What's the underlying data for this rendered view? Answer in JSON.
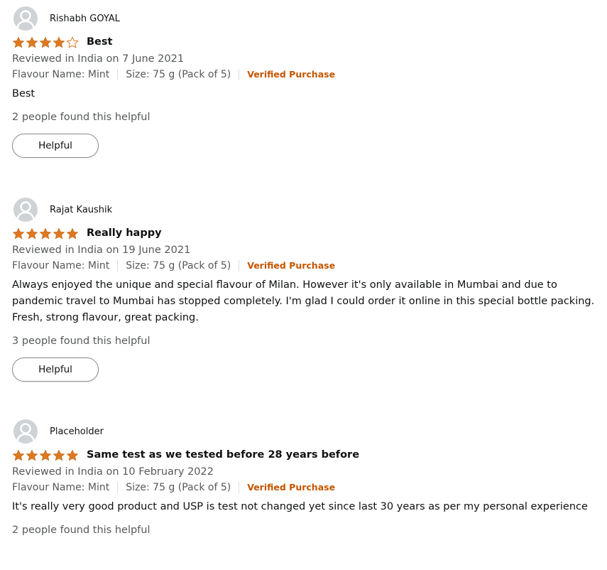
{
  "reviews": [
    {
      "reviewer": "Rishabh GOYAL",
      "rating": 4,
      "rating_max": 5,
      "title": "Best",
      "date": "Reviewed in India on 7 June 2021",
      "flavour": "Flavour Name: Mint",
      "size": "Size: 75 g (Pack of 5)",
      "verified": "Verified Purchase",
      "body": "Best",
      "helpful_count": "2 people found this helpful",
      "helpful_button": "Helpful"
    },
    {
      "reviewer": "Rajat Kaushik",
      "rating": 5,
      "rating_max": 5,
      "title": "Really happy",
      "date": "Reviewed in India on 19 June 2021",
      "flavour": "Flavour Name: Mint",
      "size": "Size: 75 g (Pack of 5)",
      "verified": "Verified Purchase",
      "body": "Always enjoyed the unique and special flavour of Milan. However it's only available in Mumbai and due to pandemic travel to Mumbai has stopped completely. I'm glad I could order it online in this special bottle packing. Fresh, strong flavour, great packing.",
      "helpful_count": "3 people found this helpful",
      "helpful_button": "Helpful"
    },
    {
      "reviewer": "Placeholder",
      "rating": 5,
      "rating_max": 5,
      "title": "Same test as we tested before 28 years before",
      "date": "Reviewed in India on 10 February 2022",
      "flavour": "Flavour Name: Mint",
      "size": "Size: 75 g (Pack of 5)",
      "verified": "Verified Purchase",
      "body": "It's really very good product and USP is test not changed yet since last 30 years as per my personal experience",
      "helpful_count": "2 people found this helpful"
    }
  ],
  "colors": {
    "star_fill": "#de7921",
    "verified": "#c45500",
    "secondary_text": "#565959",
    "avatar_bg": "#cfd3d6"
  },
  "icons": {
    "avatar": "user-avatar-icon",
    "star_full": "star-filled-icon",
    "star_empty": "star-empty-icon"
  }
}
